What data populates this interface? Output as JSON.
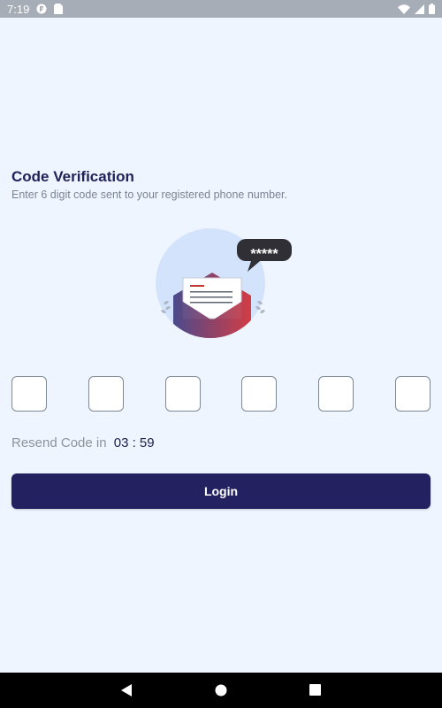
{
  "status_bar": {
    "time": "7:19",
    "icons": [
      "fire-app-icon",
      "sim-card-icon",
      "wifi-icon",
      "signal-icon",
      "battery-icon"
    ]
  },
  "verification": {
    "title": "Code Verification",
    "subtitle": "Enter 6 digit code sent to your registered phone number.",
    "illustration_mask": "*****",
    "otp_boxes": [
      "",
      "",
      "",
      "",
      "",
      ""
    ],
    "resend_label": "Resend Code in",
    "timer": "03 : 59",
    "login_label": "Login"
  },
  "nav_bar": {
    "icons": [
      "back-icon",
      "home-icon",
      "recents-icon"
    ]
  },
  "colors": {
    "background": "#eef5ff",
    "title": "#1f2158",
    "button": "#242161",
    "status_bar": "#a7adb7"
  }
}
